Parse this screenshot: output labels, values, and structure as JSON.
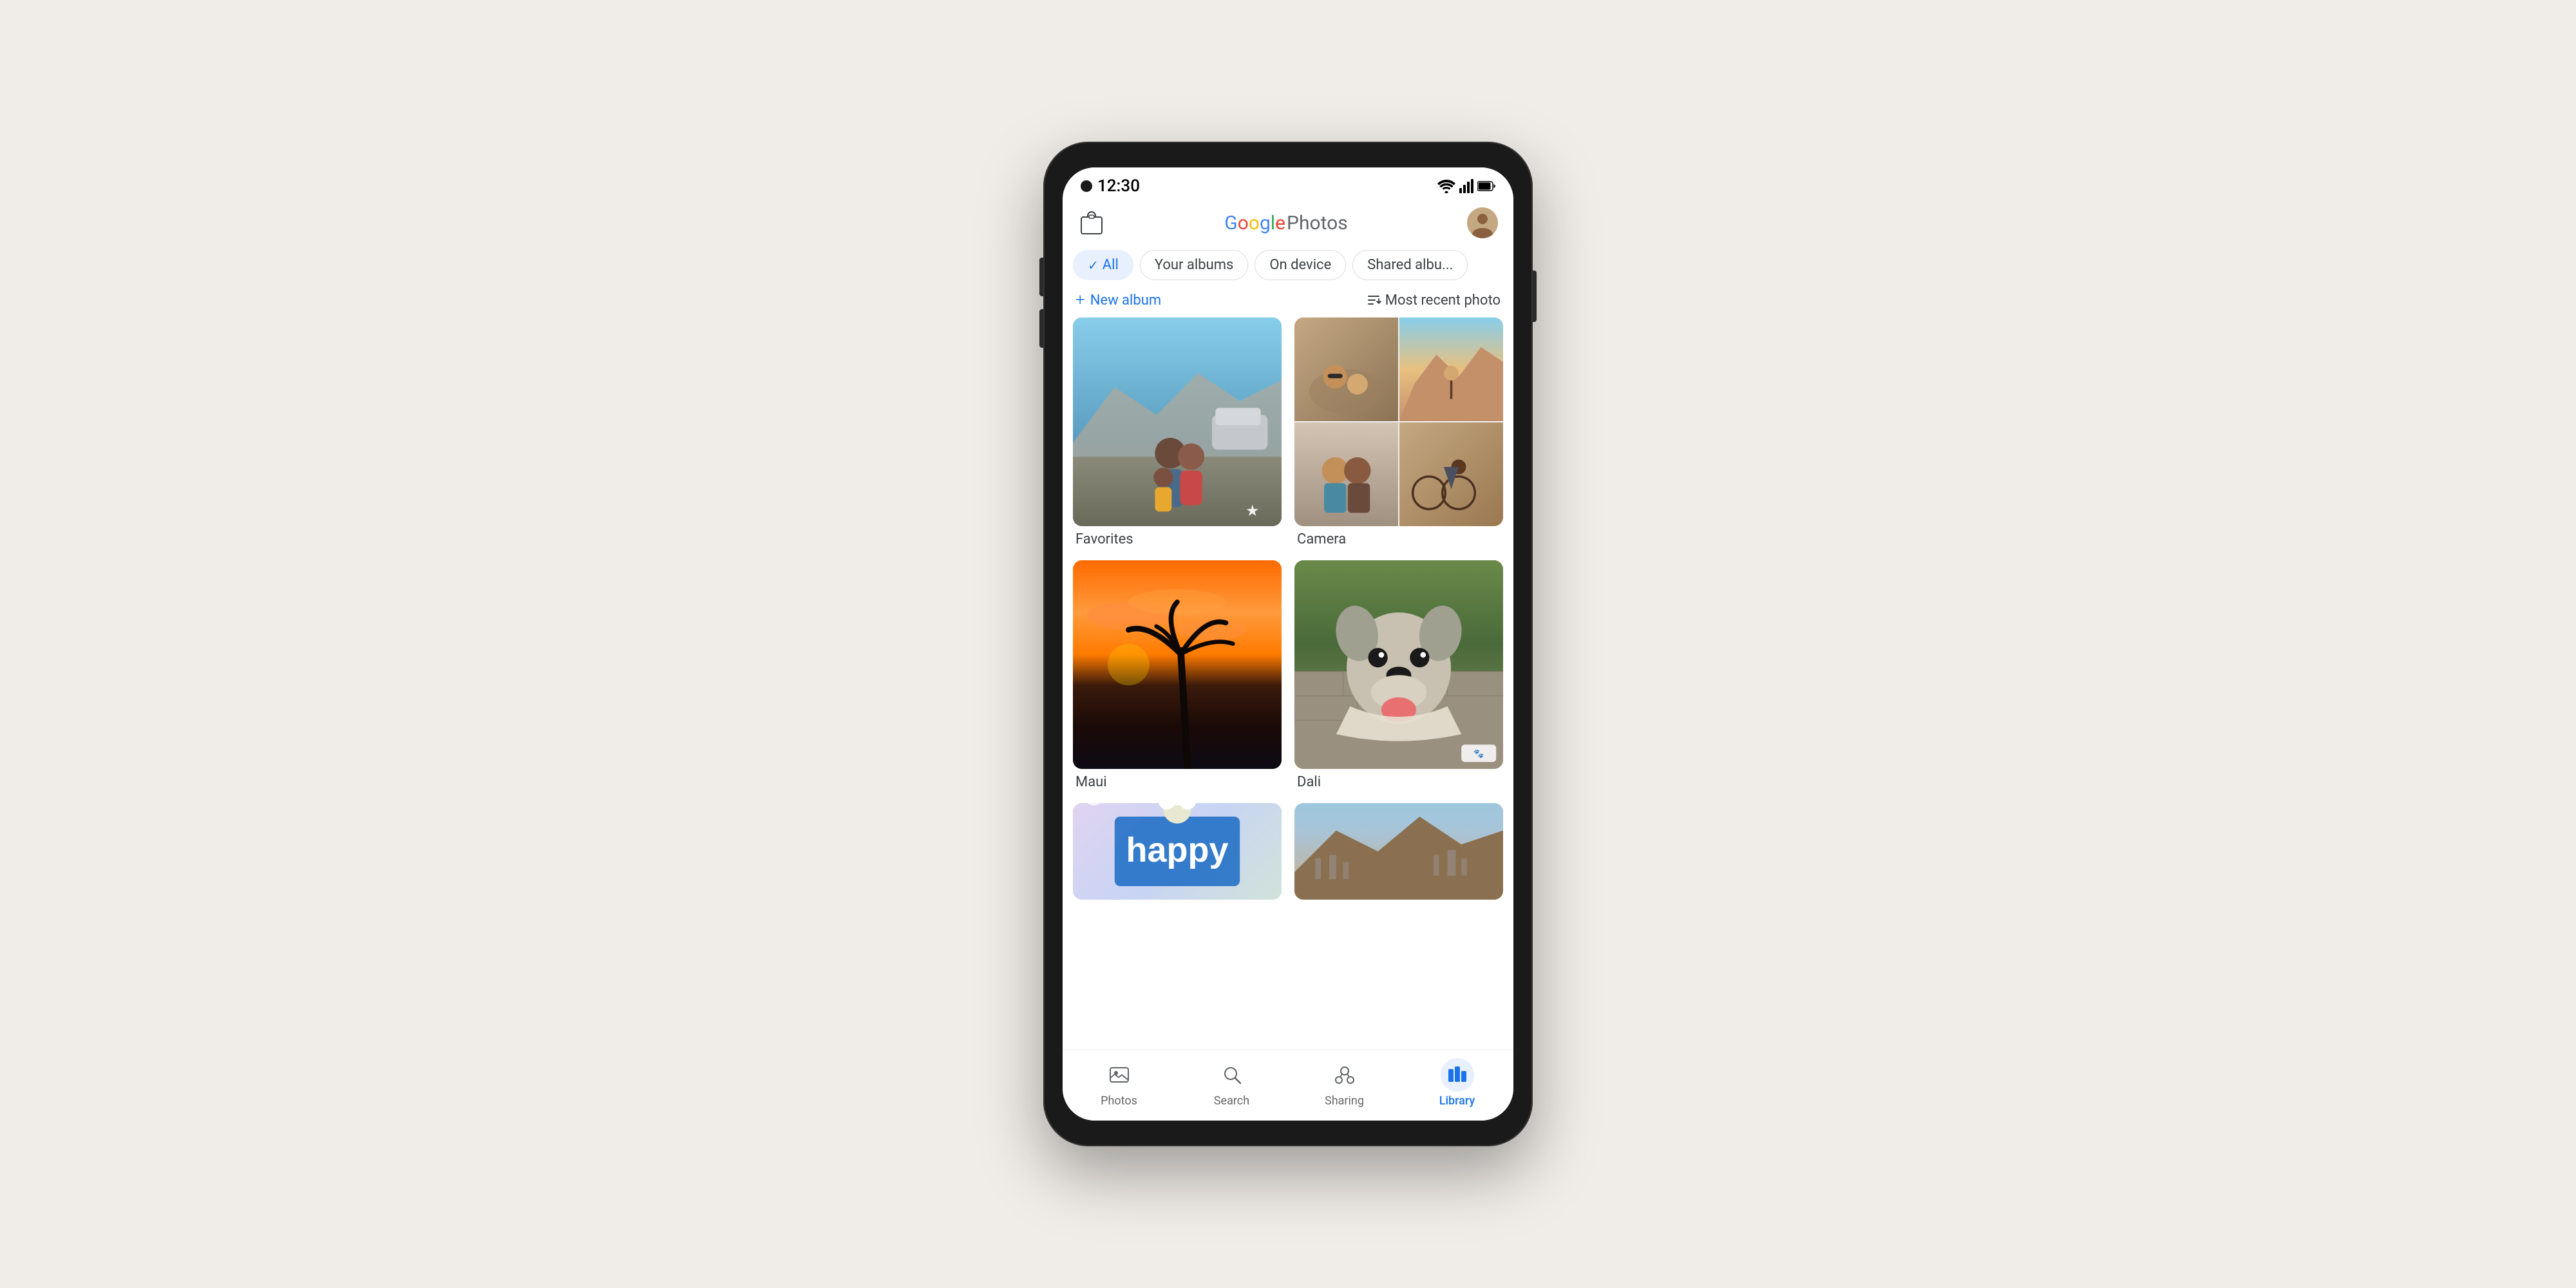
{
  "status": {
    "time": "12:30"
  },
  "header": {
    "logo_google": "Google",
    "logo_photos": "Photos",
    "bag_icon": "shopping-bag"
  },
  "filter_tabs": {
    "all_label": "All",
    "your_albums_label": "Your albums",
    "on_device_label": "On device",
    "shared_albums_label": "Shared albu..."
  },
  "actions": {
    "new_album_label": "New album",
    "sort_label": "Most recent photo"
  },
  "albums": [
    {
      "id": "favorites",
      "name": "Favorites",
      "type": "favorites"
    },
    {
      "id": "camera",
      "name": "Camera",
      "type": "camera"
    },
    {
      "id": "maui",
      "name": "Maui",
      "type": "maui"
    },
    {
      "id": "dali",
      "name": "Dali",
      "type": "dali"
    },
    {
      "id": "happy",
      "name": "",
      "type": "happy"
    },
    {
      "id": "landscape",
      "name": "",
      "type": "landscape"
    }
  ],
  "bottom_nav": {
    "items": [
      {
        "id": "photos",
        "label": "Photos",
        "active": false
      },
      {
        "id": "search",
        "label": "Search",
        "active": false
      },
      {
        "id": "sharing",
        "label": "Sharing",
        "active": false
      },
      {
        "id": "library",
        "label": "Library",
        "active": true
      }
    ]
  }
}
